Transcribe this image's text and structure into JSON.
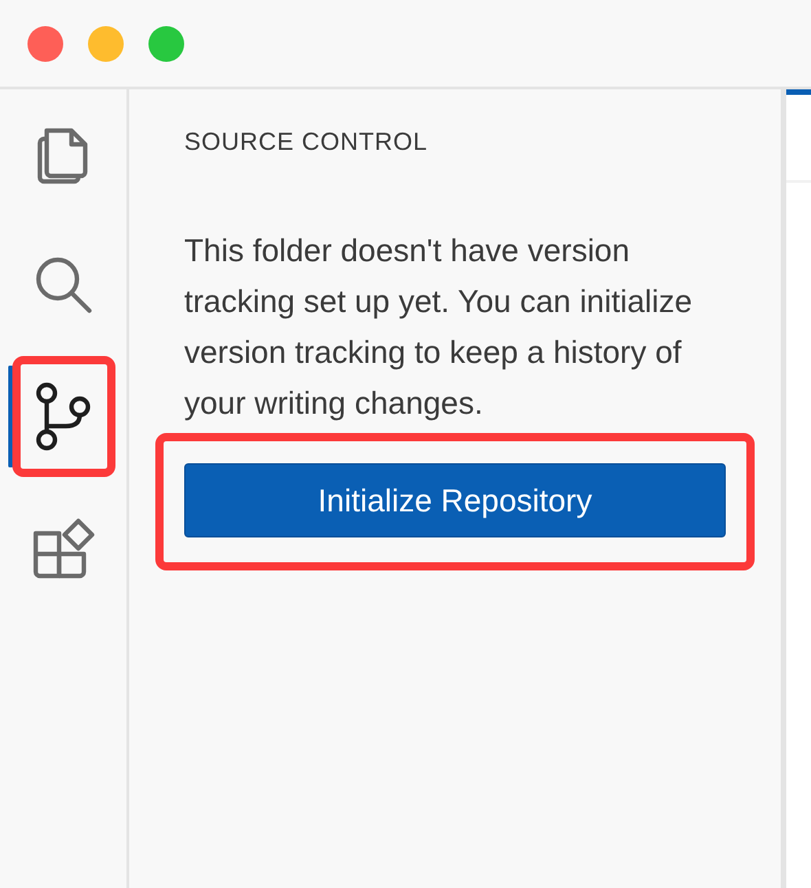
{
  "activity_bar": {
    "items": [
      {
        "kind": "files",
        "selected": false,
        "highlighted": false
      },
      {
        "kind": "search",
        "selected": false,
        "highlighted": false
      },
      {
        "kind": "source-control",
        "selected": true,
        "highlighted": true
      },
      {
        "kind": "extensions",
        "selected": false,
        "highlighted": false
      }
    ]
  },
  "sidebar": {
    "title": "SOURCE CONTROL",
    "message": "This folder doesn't have version tracking set up yet. You can initialize version tracking to keep a history of your writing changes.",
    "button": {
      "label": "Initialize Repository",
      "highlighted": true
    }
  }
}
